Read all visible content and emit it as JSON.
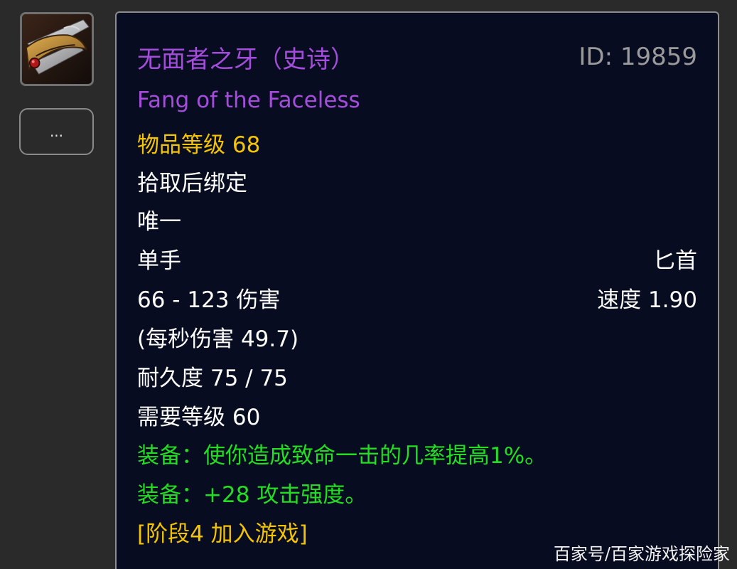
{
  "item": {
    "name_cn": "无面者之牙（史诗）",
    "id_label": "ID: 19859",
    "name_en": "Fang of the Faceless",
    "item_level": "物品等级 68",
    "binding": "拾取后绑定",
    "unique": "唯一",
    "slot": "单手",
    "weapon_type": "匕首",
    "damage": "66 - 123 伤害",
    "speed": "速度 1.90",
    "dps": "(每秒伤害 49.7)",
    "durability": "耐久度 75 / 75",
    "required_level": "需要等级 60",
    "equip_effects": [
      "装备：使你造成致命一击的几率提高1%。",
      "装备：+28 攻击强度。"
    ],
    "phase": "[阶段4 加入游戏]"
  },
  "sidebar": {
    "icon": "dagger-icon",
    "more_label": "..."
  },
  "watermark": "百家号/百家游戏探险家",
  "colors": {
    "epic_purple": "#a44ddb",
    "item_level_gold": "#f5c400",
    "equip_green": "#22dd22",
    "id_grey": "#9a9a9a",
    "tooltip_bg": "#080c20",
    "page_bg": "#2a2a2a"
  }
}
